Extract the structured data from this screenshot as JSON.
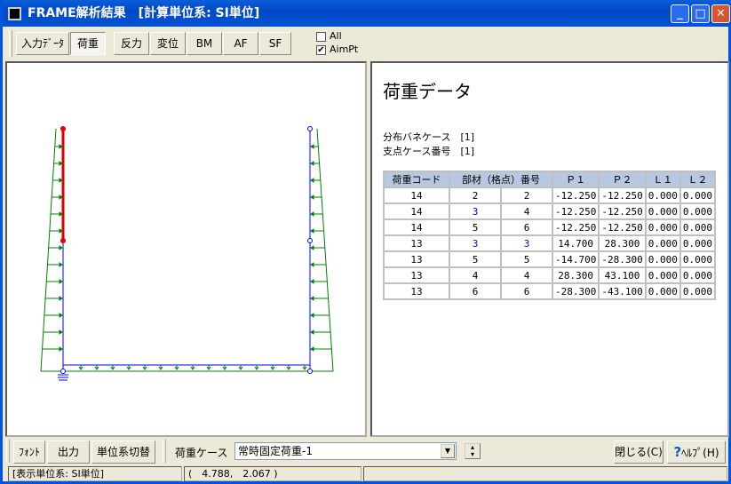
{
  "title": "FRAME解析結果　[計算単位系: SI単位]",
  "toolbar": {
    "buttons": [
      "入力ﾃﾞｰﾀ",
      "荷重",
      "反力",
      "変位",
      "BM",
      "AF",
      "SF"
    ],
    "all_label": "All",
    "all_checked": false,
    "aimpt_label": "AimPt",
    "aimpt_checked": true
  },
  "report": {
    "heading": "荷重データ",
    "line1": "分布バネケース　[1]",
    "line2": "支点ケース番号　[1]",
    "headers": [
      "荷重コード",
      "部材（格点）番号",
      "Ｐ１",
      "Ｐ２",
      "Ｌ１",
      "Ｌ２"
    ],
    "rows": [
      [
        "14",
        "2",
        "2",
        "-12.250",
        "-12.250",
        "0.000",
        "0.000"
      ],
      [
        "14",
        "3",
        "4",
        "-12.250",
        "-12.250",
        "0.000",
        "0.000"
      ],
      [
        "14",
        "5",
        "6",
        "-12.250",
        "-12.250",
        "0.000",
        "0.000"
      ],
      [
        "13",
        "3",
        "3",
        "14.700",
        "28.300",
        "0.000",
        "0.000"
      ],
      [
        "13",
        "5",
        "5",
        "-14.700",
        "-28.300",
        "0.000",
        "0.000"
      ],
      [
        "13",
        "4",
        "4",
        "28.300",
        "43.100",
        "0.000",
        "0.000"
      ],
      [
        "13",
        "6",
        "6",
        "-28.300",
        "-43.100",
        "0.000",
        "0.000"
      ]
    ]
  },
  "bottom": {
    "font": "ﾌｫﾝﾄ",
    "output": "出力",
    "unit_switch": "単位系切替",
    "load_case_label": "荷重ケース",
    "load_case_value": "常時固定荷重-1",
    "close": "閉じる(C)",
    "help": "ﾍﾙﾌﾟ(H)"
  },
  "status": {
    "unit": "[表示単位系: SI単位]",
    "coords": "(　4.788,　2.067 )"
  },
  "colors": {
    "member": "#0000ff",
    "selected": "#e00000",
    "load": "#008000"
  }
}
